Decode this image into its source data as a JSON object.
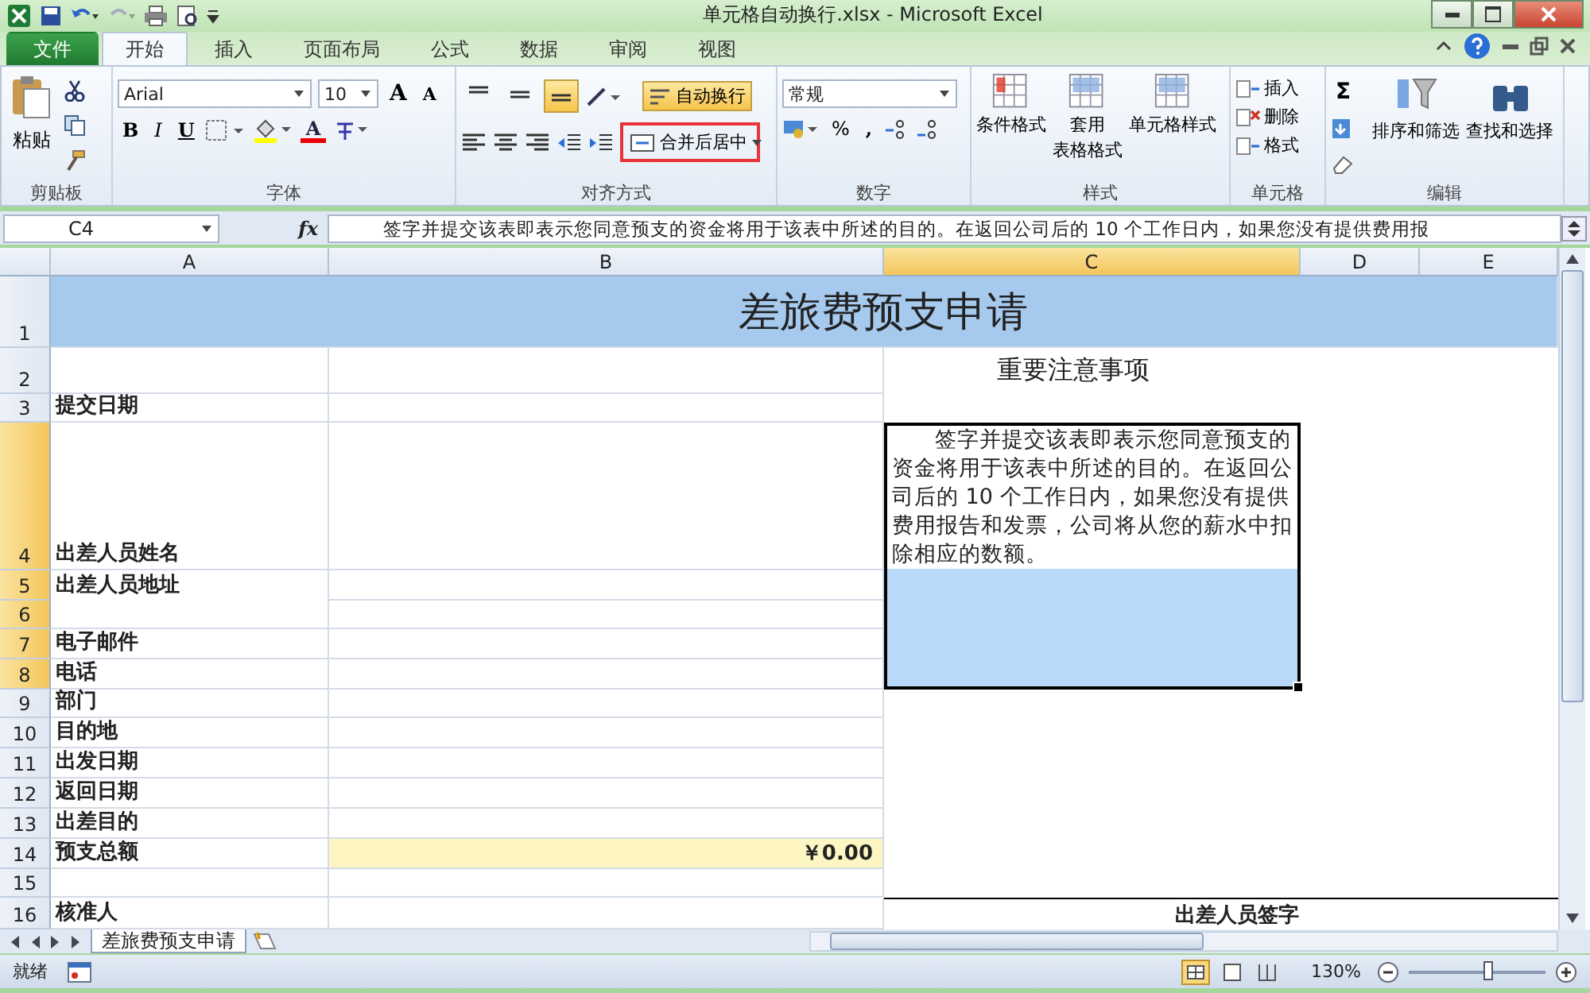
{
  "window": {
    "title": "单元格自动换行.xlsx - Microsoft Excel"
  },
  "tabs": [
    {
      "label": "文件",
      "kind": "file",
      "selected": false
    },
    {
      "label": "开始",
      "kind": "tab",
      "selected": true
    },
    {
      "label": "插入",
      "kind": "tab",
      "selected": false
    },
    {
      "label": "页面布局",
      "kind": "tab",
      "selected": false
    },
    {
      "label": "公式",
      "kind": "tab",
      "selected": false
    },
    {
      "label": "数据",
      "kind": "tab",
      "selected": false
    },
    {
      "label": "审阅",
      "kind": "tab",
      "selected": false
    },
    {
      "label": "视图",
      "kind": "tab",
      "selected": false
    }
  ],
  "ribbon": {
    "clipboard": {
      "label": "剪贴板",
      "paste": "粘贴"
    },
    "font": {
      "label": "字体",
      "font_name": "Arial",
      "font_size": "10",
      "grow": "A",
      "shrink": "A",
      "bold": "B",
      "italic": "I",
      "underline": "U",
      "font_color": "A"
    },
    "alignment": {
      "label": "对齐方式",
      "vertical": [
        {
          "selected": false
        },
        {
          "selected": false
        },
        {
          "selected": true
        }
      ],
      "wrap_text": {
        "label": "自动换行",
        "selected": true
      },
      "merge_center": {
        "label": "合并后居中",
        "highlighted": true
      }
    },
    "number": {
      "label": "数字",
      "format": "常规",
      "percent": "%",
      "comma": ","
    },
    "styles": {
      "label": "样式",
      "buttons": [
        {
          "label": "条件格式"
        },
        {
          "label": "套用",
          "label2": "表格格式"
        },
        {
          "label": "单元格样式"
        }
      ]
    },
    "cells": {
      "label": "单元格",
      "buttons": [
        {
          "label": "插入"
        },
        {
          "label": "删除"
        },
        {
          "label": "格式"
        }
      ]
    },
    "editing": {
      "label": "编辑",
      "sum": "Σ",
      "buttons": [
        {
          "label": "排序和筛选"
        },
        {
          "label": "查找和选择"
        }
      ]
    }
  },
  "formula_bar": {
    "name_box": "C4",
    "fx": "fx",
    "content": "签字并提交该表即表示您同意预支的资金将用于该表中所述的目的。在返回公司后的 10 个工作日内，如果您没有提供费用报"
  },
  "columns": [
    {
      "label": "A",
      "selected": false
    },
    {
      "label": "B",
      "selected": false
    },
    {
      "label": "C",
      "selected": true
    },
    {
      "label": "D",
      "selected": false
    },
    {
      "label": "E",
      "selected": false
    }
  ],
  "rows": [
    {
      "number": "1",
      "selected": false,
      "title": "差旅费预支申请"
    },
    {
      "number": "2",
      "selected": false,
      "c": "重要注意事项"
    },
    {
      "number": "3",
      "selected": false,
      "a": "提交日期"
    },
    {
      "number": "4",
      "selected": true,
      "a": "出差人员姓名",
      "c": "签字并提交该表即表示您同意预支的资金将用于该表中所述的目的。在返回公司后的 10 个工作日内，如果您没有提供费用报告和发票，公司将从您的薪水中扣除相应的数额。"
    },
    {
      "number": "5",
      "selected": true,
      "a": "出差人员地址"
    },
    {
      "number": "6",
      "selected": true
    },
    {
      "number": "7",
      "selected": true,
      "a": "电子邮件"
    },
    {
      "number": "8",
      "selected": true,
      "a": "电话"
    },
    {
      "number": "9",
      "selected": false,
      "a": "部门"
    },
    {
      "number": "10",
      "selected": false,
      "a": "目的地"
    },
    {
      "number": "11",
      "selected": false,
      "a": "出发日期"
    },
    {
      "number": "12",
      "selected": false,
      "a": "返回日期"
    },
    {
      "number": "13",
      "selected": false,
      "a": "出差目的"
    },
    {
      "number": "14",
      "selected": false,
      "a": "预支总额",
      "b": "￥0.00"
    },
    {
      "number": "15",
      "selected": false
    },
    {
      "number": "16",
      "selected": false,
      "a": "核准人",
      "c": "出差人员签字"
    }
  ],
  "sheet_tabs": [
    {
      "label": "差旅费预支申请",
      "selected": true
    }
  ],
  "status_bar": {
    "mode": "就绪",
    "zoom": "130%",
    "zoom_slider": {
      "level": 0.58
    }
  }
}
